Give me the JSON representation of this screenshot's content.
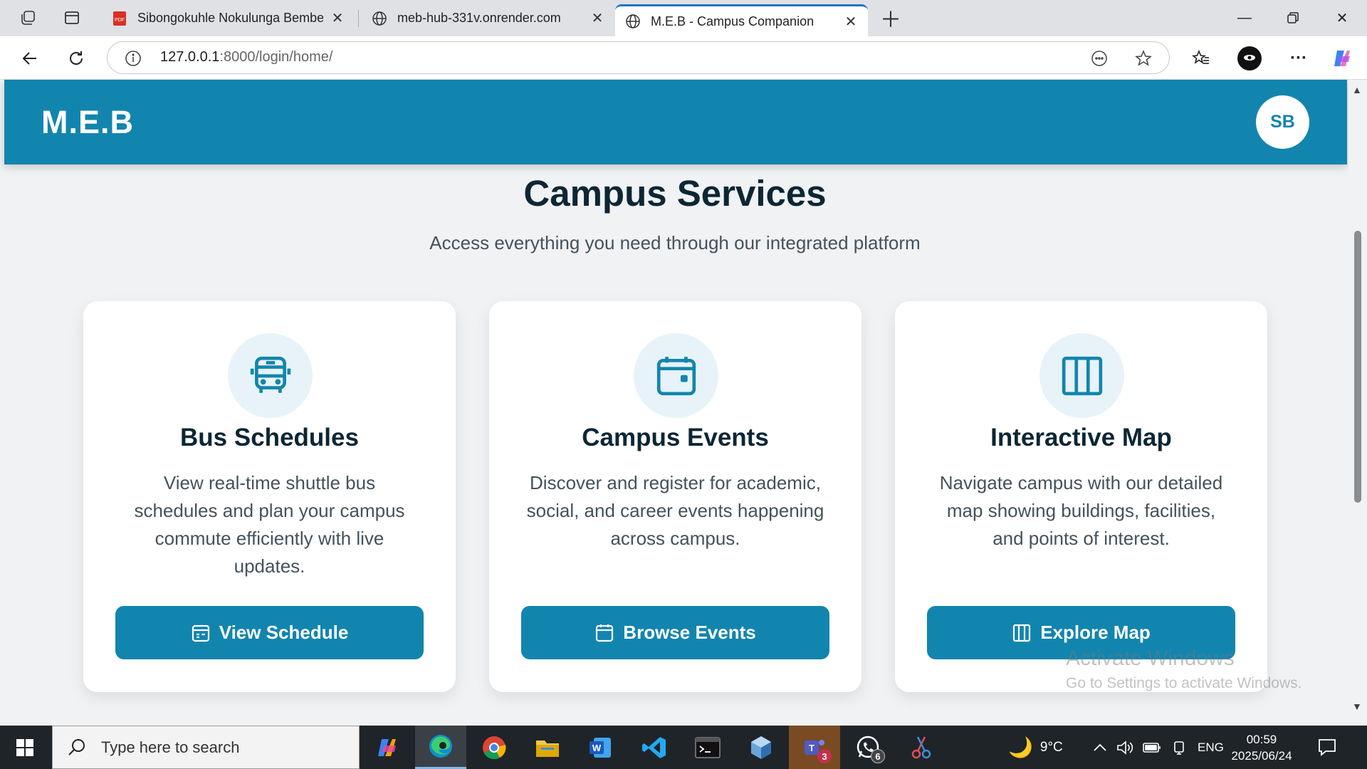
{
  "browser": {
    "tabs": [
      {
        "title": "Sibongokuhle Nokulunga Bembe",
        "icon": "pdf-icon",
        "active": false
      },
      {
        "title": "meb-hub-331v.onrender.com",
        "icon": "globe-icon",
        "active": false
      },
      {
        "title": "M.E.B - Campus Companion",
        "icon": "globe-icon",
        "active": true
      }
    ],
    "url_host": "127.0.0.1",
    "url_rest": ":8000/login/home/"
  },
  "app": {
    "brand": "M.E.B",
    "avatar_initials": "SB",
    "accent_color": "#1285ae"
  },
  "services": {
    "title": "Campus Services",
    "subtitle": "Access everything you need through our integrated platform",
    "cards": [
      {
        "title": "Bus Schedules",
        "description": "View real-time shuttle bus schedules and plan your campus commute efficiently with live updates.",
        "button": "View Schedule",
        "icon": "bus-icon",
        "button_icon": "calendar-week-icon"
      },
      {
        "title": "Campus Events",
        "description": "Discover and register for academic, social, and career events happening across campus.",
        "button": "Browse Events",
        "icon": "calendar-icon",
        "button_icon": "calendar-icon"
      },
      {
        "title": "Interactive Map",
        "description": "Navigate campus with our detailed map showing buildings, facilities, and points of interest.",
        "button": "Explore Map",
        "icon": "map-icon",
        "button_icon": "map-icon"
      }
    ]
  },
  "watermark": {
    "line1": "Activate Windows",
    "line2": "Go to Settings to activate Windows."
  },
  "taskbar": {
    "search_placeholder": "Type here to search",
    "teams_badge": "3",
    "whatsapp_badge": "6",
    "weather": "9°C",
    "language": "ENG",
    "time": "00:59",
    "date": "2025/06/24"
  }
}
